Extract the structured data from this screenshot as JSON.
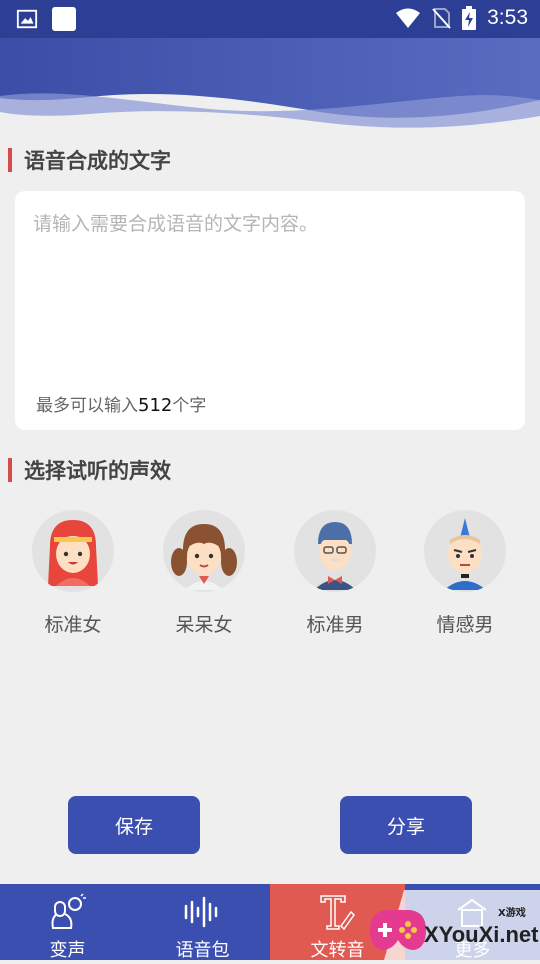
{
  "status_bar": {
    "time": "3:53",
    "icons": [
      "image-icon",
      "app-square-icon",
      "wifi-icon",
      "no-sim-icon",
      "battery-charging-icon"
    ]
  },
  "colors": {
    "primary": "#3b4fb0",
    "status_bar": "#2d3f95",
    "accent": "#e05a52",
    "section_bar": "#d44c4c",
    "background": "#efefef"
  },
  "text_section": {
    "title": "语音合成的文字",
    "placeholder": "请输入需要合成语音的文字内容。",
    "limit_prefix": "最多可以输入",
    "limit_number": "512",
    "limit_suffix": "个字"
  },
  "voice_section": {
    "title": "选择试听的声效",
    "voices": [
      {
        "label": "标准女",
        "icon": "red-hair-woman-avatar-icon"
      },
      {
        "label": "呆呆女",
        "icon": "pigtail-girl-avatar-icon"
      },
      {
        "label": "标准男",
        "icon": "bowtie-man-avatar-icon"
      },
      {
        "label": "情感男",
        "icon": "mohawk-man-avatar-icon"
      }
    ]
  },
  "buttons": {
    "save": "保存",
    "share": "分享"
  },
  "bottom_nav": {
    "items": [
      {
        "label": "变声",
        "icon": "voice-change-icon"
      },
      {
        "label": "语音包",
        "icon": "soundwave-icon"
      },
      {
        "label": "文转音",
        "icon": "text-to-speech-icon",
        "active": true
      },
      {
        "label": "更多",
        "icon": "more-icon"
      }
    ]
  },
  "watermark": {
    "text": "XYouXi.net",
    "small_text": "X游戏"
  }
}
